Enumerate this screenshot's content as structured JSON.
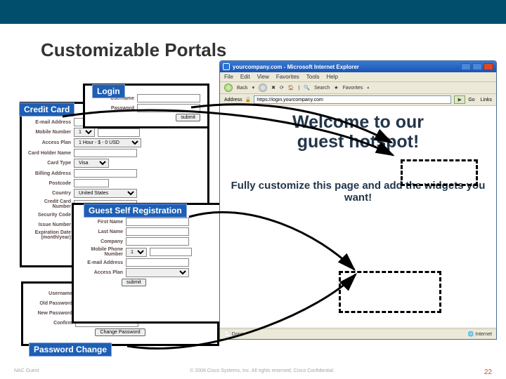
{
  "title": "Customizable Portals",
  "login": {
    "band": "Login",
    "username_label": "Username",
    "password_label": "Password",
    "submit": "submit"
  },
  "credit": {
    "band": "Credit Card",
    "email_label": "E-mail Address",
    "mobile_label": "Mobile Number",
    "mobile_code": "1",
    "access_label": "Access Plan",
    "access_value": "1 Hour - $ - 0 USD",
    "holder_label": "Card Holder Name",
    "type_label": "Card Type",
    "type_value": "Visa",
    "billing_label": "Billing Address",
    "postcode_label": "Postcode",
    "country_label": "Country",
    "country_value": "United States",
    "cc_label": "Credit Card Number",
    "sec_label": "Security Code",
    "issue_label": "Issue Number",
    "exp_label": "Expiration Date (month/year)"
  },
  "guest": {
    "band": "Guest Self Registration",
    "first_label": "First Name",
    "last_label": "Last Name",
    "company_label": "Company",
    "mobile_label": "Mobile Phone Number",
    "mobile_code": "1",
    "email_label": "E-mail Address",
    "access_label": "Access Plan",
    "submit": "submit"
  },
  "pwd": {
    "band": "Password Change",
    "username_label": "Username",
    "old_label": "Old Password",
    "new_label": "New Password",
    "confirm_label": "Confirm",
    "button": "Change Password"
  },
  "browser": {
    "title": "yourcompany.com - Microsoft Internet Explorer",
    "menu": {
      "file": "File",
      "edit": "Edit",
      "view": "View",
      "favorites": "Favorites",
      "tools": "Tools",
      "help": "Help"
    },
    "tool": {
      "back": "Back",
      "search": "Search",
      "favorites": "Favorites"
    },
    "addr_label": "Address",
    "addr_value": "https://login.yourcompany.com",
    "go": "Go",
    "links": "Links",
    "status_done": "Done",
    "status_zone": "Internet"
  },
  "page": {
    "headline1": "Welcome to our",
    "headline2": "guest hotspot!",
    "sub": "Fully customize this page and add the widgets you want!"
  },
  "footer": {
    "left": "NAC Guest",
    "mid": "© 2008 Cisco Systems, Inc. All rights reserved.   Cisco Confidential",
    "page": "22"
  }
}
